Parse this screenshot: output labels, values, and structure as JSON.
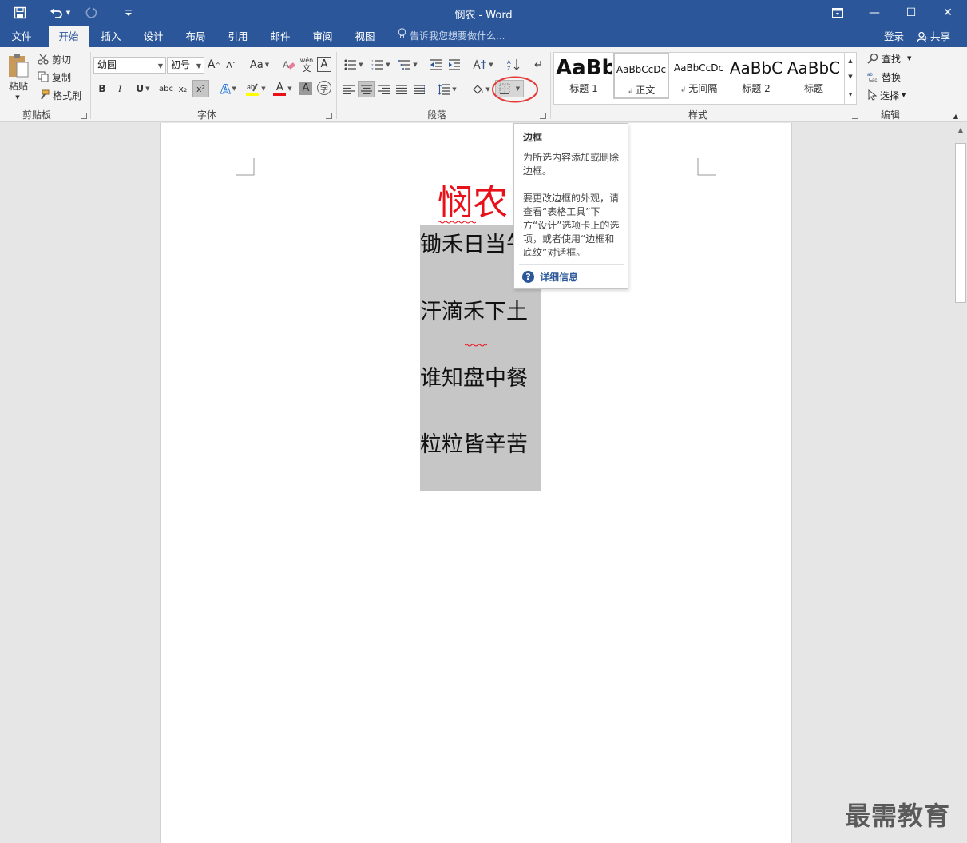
{
  "titlebar": {
    "title": "悯农 - Word",
    "icons": [
      "save-icon",
      "undo-icon",
      "redo-icon",
      "customize-qat-icon",
      "ribbon-display-icon",
      "minimize-icon",
      "maximize-icon",
      "close-icon"
    ],
    "minimize_glyph": "—",
    "maximize_glyph": "☐",
    "close_glyph": "✕"
  },
  "tabs": {
    "items": [
      "文件",
      "开始",
      "插入",
      "设计",
      "布局",
      "引用",
      "邮件",
      "审阅",
      "视图"
    ],
    "active": "开始",
    "tell_me": "告诉我您想要做什么...",
    "login": "登录",
    "share": "共享"
  },
  "ribbon": {
    "clipboard": {
      "label": "剪贴板",
      "paste": "粘贴",
      "cut": "剪切",
      "copy": "复制",
      "format_painter": "格式刷"
    },
    "font": {
      "label": "字体",
      "font_name": "幼圆",
      "font_size": "初号",
      "grow": "A",
      "shrink": "A",
      "change_case": "Aa",
      "bold": "B",
      "italic": "I",
      "underline": "U",
      "strikethrough": "abc",
      "subscript": "x₂",
      "superscript": "x²",
      "font_color": "A",
      "char_shading": "A",
      "phonetic": "wén",
      "phonetic_char": "文",
      "char_border": "A",
      "enclose_char": "字"
    },
    "paragraph": {
      "label": "段落"
    },
    "styles": {
      "label": "样式",
      "items": [
        {
          "preview": "AaBb",
          "name": "标题 1"
        },
        {
          "preview": "AaBbCcDc",
          "name": "正文"
        },
        {
          "preview": "AaBbCcDc",
          "name": "无间隔"
        },
        {
          "preview": "AaBbC",
          "name": "标题 2"
        },
        {
          "preview": "AaBbC",
          "name": "标题"
        }
      ],
      "selected": "正文"
    },
    "editing": {
      "label": "编辑",
      "find": "查找",
      "replace": "替换",
      "select": "选择"
    }
  },
  "document": {
    "title": "悯农",
    "lines": [
      "锄禾日当午",
      "汗滴禾下土",
      "谁知盘中餐",
      "粒粒皆辛苦"
    ],
    "title_color": "#e8111a",
    "selection_color": "#c6c6c6"
  },
  "tooltip": {
    "title": "边框",
    "desc": "为所选内容添加或删除边框。",
    "desc2": "要更改边框的外观，请查看“表格工具”下方“设计”选项卡上的选项，或者使用“边框和底纹”对话框。",
    "more": "详细信息"
  },
  "watermark": "最需教育",
  "colors": {
    "accent": "#2b579a",
    "ribbon_bg": "#f3f3f3",
    "highlight_circle": "#e53935"
  }
}
